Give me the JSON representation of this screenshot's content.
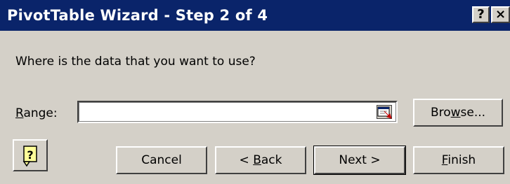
{
  "window": {
    "title": "PivotTable Wizard - Step 2 of 4",
    "help_glyph": "?",
    "close_glyph": "×"
  },
  "prompt": "Where is the data that you want to use?",
  "range": {
    "label_access": "R",
    "label_rest": "ange:",
    "value": "",
    "collapse_icon": "range-collapse-icon"
  },
  "buttons": {
    "browse": {
      "pre": "Bro",
      "acc": "w",
      "post": "se..."
    },
    "cancel": {
      "pre": "",
      "acc": "",
      "post": "Cancel"
    },
    "back": {
      "pre": "< ",
      "acc": "B",
      "post": "ack"
    },
    "next": {
      "pre": "",
      "acc": "",
      "post": "Next >"
    },
    "finish": {
      "pre": "",
      "acc": "F",
      "post": "inish"
    }
  },
  "icons": {
    "office_assistant": "office-assistant-icon"
  },
  "colors": {
    "titlebar": "#0a246a",
    "face": "#d4d0c8"
  }
}
